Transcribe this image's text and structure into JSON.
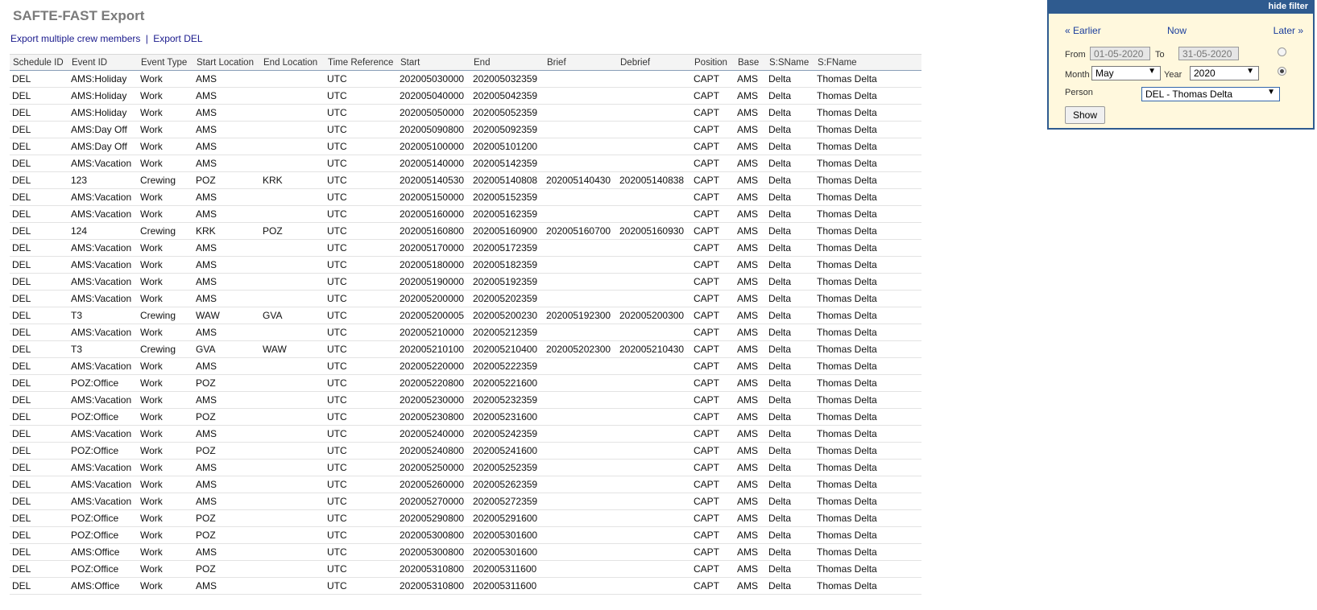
{
  "page": {
    "title": "SAFTE-FAST Export",
    "links": {
      "export_multiple": "Export multiple crew members",
      "separator": "|",
      "export_del": "Export DEL"
    }
  },
  "table": {
    "columns": [
      "Schedule ID",
      "Event ID",
      "Event Type",
      "Start Location",
      "End Location",
      "Time Reference",
      "Start",
      "End",
      "Brief",
      "Debrief",
      "Position",
      "Base",
      "S:SName",
      "S:FName"
    ],
    "rows": [
      [
        "DEL",
        "AMS:Holiday",
        "Work",
        "AMS",
        "",
        "UTC",
        "202005030000",
        "202005032359",
        "",
        "",
        "CAPT",
        "AMS",
        "Delta",
        "Thomas Delta"
      ],
      [
        "DEL",
        "AMS:Holiday",
        "Work",
        "AMS",
        "",
        "UTC",
        "202005040000",
        "202005042359",
        "",
        "",
        "CAPT",
        "AMS",
        "Delta",
        "Thomas Delta"
      ],
      [
        "DEL",
        "AMS:Holiday",
        "Work",
        "AMS",
        "",
        "UTC",
        "202005050000",
        "202005052359",
        "",
        "",
        "CAPT",
        "AMS",
        "Delta",
        "Thomas Delta"
      ],
      [
        "DEL",
        "AMS:Day Off",
        "Work",
        "AMS",
        "",
        "UTC",
        "202005090800",
        "202005092359",
        "",
        "",
        "CAPT",
        "AMS",
        "Delta",
        "Thomas Delta"
      ],
      [
        "DEL",
        "AMS:Day Off",
        "Work",
        "AMS",
        "",
        "UTC",
        "202005100000",
        "202005101200",
        "",
        "",
        "CAPT",
        "AMS",
        "Delta",
        "Thomas Delta"
      ],
      [
        "DEL",
        "AMS:Vacation",
        "Work",
        "AMS",
        "",
        "UTC",
        "202005140000",
        "202005142359",
        "",
        "",
        "CAPT",
        "AMS",
        "Delta",
        "Thomas Delta"
      ],
      [
        "DEL",
        "123",
        "Crewing",
        "POZ",
        "KRK",
        "UTC",
        "202005140530",
        "202005140808",
        "202005140430",
        "202005140838",
        "CAPT",
        "AMS",
        "Delta",
        "Thomas Delta"
      ],
      [
        "DEL",
        "AMS:Vacation",
        "Work",
        "AMS",
        "",
        "UTC",
        "202005150000",
        "202005152359",
        "",
        "",
        "CAPT",
        "AMS",
        "Delta",
        "Thomas Delta"
      ],
      [
        "DEL",
        "AMS:Vacation",
        "Work",
        "AMS",
        "",
        "UTC",
        "202005160000",
        "202005162359",
        "",
        "",
        "CAPT",
        "AMS",
        "Delta",
        "Thomas Delta"
      ],
      [
        "DEL",
        "124",
        "Crewing",
        "KRK",
        "POZ",
        "UTC",
        "202005160800",
        "202005160900",
        "202005160700",
        "202005160930",
        "CAPT",
        "AMS",
        "Delta",
        "Thomas Delta"
      ],
      [
        "DEL",
        "AMS:Vacation",
        "Work",
        "AMS",
        "",
        "UTC",
        "202005170000",
        "202005172359",
        "",
        "",
        "CAPT",
        "AMS",
        "Delta",
        "Thomas Delta"
      ],
      [
        "DEL",
        "AMS:Vacation",
        "Work",
        "AMS",
        "",
        "UTC",
        "202005180000",
        "202005182359",
        "",
        "",
        "CAPT",
        "AMS",
        "Delta",
        "Thomas Delta"
      ],
      [
        "DEL",
        "AMS:Vacation",
        "Work",
        "AMS",
        "",
        "UTC",
        "202005190000",
        "202005192359",
        "",
        "",
        "CAPT",
        "AMS",
        "Delta",
        "Thomas Delta"
      ],
      [
        "DEL",
        "AMS:Vacation",
        "Work",
        "AMS",
        "",
        "UTC",
        "202005200000",
        "202005202359",
        "",
        "",
        "CAPT",
        "AMS",
        "Delta",
        "Thomas Delta"
      ],
      [
        "DEL",
        "T3",
        "Crewing",
        "WAW",
        "GVA",
        "UTC",
        "202005200005",
        "202005200230",
        "202005192300",
        "202005200300",
        "CAPT",
        "AMS",
        "Delta",
        "Thomas Delta"
      ],
      [
        "DEL",
        "AMS:Vacation",
        "Work",
        "AMS",
        "",
        "UTC",
        "202005210000",
        "202005212359",
        "",
        "",
        "CAPT",
        "AMS",
        "Delta",
        "Thomas Delta"
      ],
      [
        "DEL",
        "T3",
        "Crewing",
        "GVA",
        "WAW",
        "UTC",
        "202005210100",
        "202005210400",
        "202005202300",
        "202005210430",
        "CAPT",
        "AMS",
        "Delta",
        "Thomas Delta"
      ],
      [
        "DEL",
        "AMS:Vacation",
        "Work",
        "AMS",
        "",
        "UTC",
        "202005220000",
        "202005222359",
        "",
        "",
        "CAPT",
        "AMS",
        "Delta",
        "Thomas Delta"
      ],
      [
        "DEL",
        "POZ:Office",
        "Work",
        "POZ",
        "",
        "UTC",
        "202005220800",
        "202005221600",
        "",
        "",
        "CAPT",
        "AMS",
        "Delta",
        "Thomas Delta"
      ],
      [
        "DEL",
        "AMS:Vacation",
        "Work",
        "AMS",
        "",
        "UTC",
        "202005230000",
        "202005232359",
        "",
        "",
        "CAPT",
        "AMS",
        "Delta",
        "Thomas Delta"
      ],
      [
        "DEL",
        "POZ:Office",
        "Work",
        "POZ",
        "",
        "UTC",
        "202005230800",
        "202005231600",
        "",
        "",
        "CAPT",
        "AMS",
        "Delta",
        "Thomas Delta"
      ],
      [
        "DEL",
        "AMS:Vacation",
        "Work",
        "AMS",
        "",
        "UTC",
        "202005240000",
        "202005242359",
        "",
        "",
        "CAPT",
        "AMS",
        "Delta",
        "Thomas Delta"
      ],
      [
        "DEL",
        "POZ:Office",
        "Work",
        "POZ",
        "",
        "UTC",
        "202005240800",
        "202005241600",
        "",
        "",
        "CAPT",
        "AMS",
        "Delta",
        "Thomas Delta"
      ],
      [
        "DEL",
        "AMS:Vacation",
        "Work",
        "AMS",
        "",
        "UTC",
        "202005250000",
        "202005252359",
        "",
        "",
        "CAPT",
        "AMS",
        "Delta",
        "Thomas Delta"
      ],
      [
        "DEL",
        "AMS:Vacation",
        "Work",
        "AMS",
        "",
        "UTC",
        "202005260000",
        "202005262359",
        "",
        "",
        "CAPT",
        "AMS",
        "Delta",
        "Thomas Delta"
      ],
      [
        "DEL",
        "AMS:Vacation",
        "Work",
        "AMS",
        "",
        "UTC",
        "202005270000",
        "202005272359",
        "",
        "",
        "CAPT",
        "AMS",
        "Delta",
        "Thomas Delta"
      ],
      [
        "DEL",
        "POZ:Office",
        "Work",
        "POZ",
        "",
        "UTC",
        "202005290800",
        "202005291600",
        "",
        "",
        "CAPT",
        "AMS",
        "Delta",
        "Thomas Delta"
      ],
      [
        "DEL",
        "POZ:Office",
        "Work",
        "POZ",
        "",
        "UTC",
        "202005300800",
        "202005301600",
        "",
        "",
        "CAPT",
        "AMS",
        "Delta",
        "Thomas Delta"
      ],
      [
        "DEL",
        "AMS:Office",
        "Work",
        "AMS",
        "",
        "UTC",
        "202005300800",
        "202005301600",
        "",
        "",
        "CAPT",
        "AMS",
        "Delta",
        "Thomas Delta"
      ],
      [
        "DEL",
        "POZ:Office",
        "Work",
        "POZ",
        "",
        "UTC",
        "202005310800",
        "202005311600",
        "",
        "",
        "CAPT",
        "AMS",
        "Delta",
        "Thomas Delta"
      ],
      [
        "DEL",
        "AMS:Office",
        "Work",
        "AMS",
        "",
        "UTC",
        "202005310800",
        "202005311600",
        "",
        "",
        "CAPT",
        "AMS",
        "Delta",
        "Thomas Delta"
      ]
    ]
  },
  "filter": {
    "hide_label": "hide filter",
    "earlier": "« Earlier",
    "now": "Now",
    "later": "Later »",
    "from_label": "From",
    "from_value": "01-05-2020",
    "to_label": "To",
    "to_value": "31-05-2020",
    "month_label": "Month",
    "month_value": "May",
    "year_label": "Year",
    "year_value": "2020",
    "person_label": "Person",
    "person_value": "DEL - Thomas Delta",
    "dropdown_arrow": "▼",
    "show_label": "Show"
  }
}
